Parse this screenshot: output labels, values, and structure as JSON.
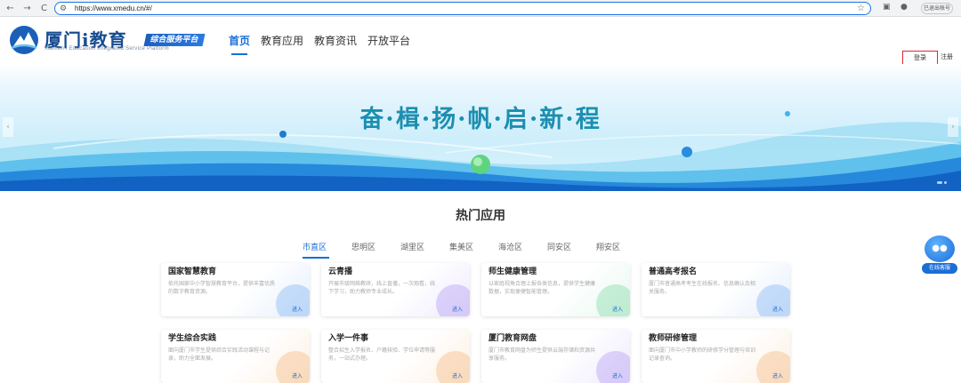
{
  "browser": {
    "back_icon": "←",
    "forward_icon": "→",
    "reload_icon": "C",
    "tune_icon": "⚙",
    "url": "https://www.xmedu.cn/#/",
    "star_icon": "☆",
    "profile_label": "已退出帐号"
  },
  "header": {
    "logo_title": "厦门i教育",
    "logo_badge": "综合服务平台",
    "logo_subtitle": "Xiamen i Education Integrated Service Platform",
    "nav": [
      "首页",
      "教育应用",
      "教育资讯",
      "开放平台"
    ],
    "login_label": "登录",
    "register_label": "注册"
  },
  "banner": {
    "slogan": "奋·楫·扬·帆·启·新·程",
    "prev_icon": "‹",
    "next_icon": "›"
  },
  "hot_apps": {
    "title": "热门应用",
    "tabs": [
      "市直区",
      "思明区",
      "湖里区",
      "集美区",
      "海沧区",
      "同安区",
      "翔安区"
    ],
    "cards": [
      {
        "title": "国家智慧教育",
        "desc": "依托国家中小学智慧教育平台，提供丰富优质的数字教育资源。",
        "enter": "进入",
        "theme": "c-blue",
        "deco": "#6fa8f0"
      },
      {
        "title": "云青播",
        "desc": "开展市级网络教研，线上直播，一次观看，线下学习，助力教师专业成长。",
        "enter": "进入",
        "theme": "c-purple",
        "deco": "#a58cf0"
      },
      {
        "title": "师生健康管理",
        "desc": "以家庭视角合理上报各类信息，提供学生健康数据，实现便捷智能管理。",
        "enter": "进入",
        "theme": "c-green",
        "deco": "#6fd39a"
      },
      {
        "title": "普通高考报名",
        "desc": "厦门市普通高考考生在线报名、信息确认及相关服务。",
        "enter": "进入",
        "theme": "c-blue",
        "deco": "#6fa8f0"
      },
      {
        "title": "学生综合实践",
        "desc": "面向厦门市学生提供综合实践活动课程与记录，助力全面发展。",
        "enter": "进入",
        "theme": "c-orange",
        "deco": "#f4b071"
      },
      {
        "title": "入学一件事",
        "desc": "整合招生入学报名、户籍核验、学位申请等服务，一站式办理。",
        "enter": "进入",
        "theme": "c-orange",
        "deco": "#f4b071"
      },
      {
        "title": "厦门教育网盘",
        "desc": "厦门市教育网盘为师生提供云端存储和资源共享服务。",
        "enter": "进入",
        "theme": "c-purple",
        "deco": "#a58cf0"
      },
      {
        "title": "教师研修管理",
        "desc": "面向厦门市中小学教师的研修学分管理与培训记录查询。",
        "enter": "进入",
        "theme": "c-orange",
        "deco": "#f4b071"
      }
    ]
  },
  "service": {
    "icon": "●●",
    "label": "在线客服"
  }
}
